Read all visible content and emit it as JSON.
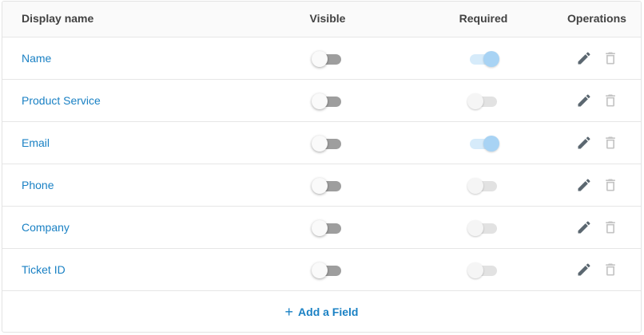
{
  "table": {
    "headers": {
      "display_name": "Display name",
      "visible": "Visible",
      "required": "Required",
      "operations": "Operations"
    },
    "rows": [
      {
        "name": "Name",
        "visible": false,
        "required": true,
        "required_enabled": true
      },
      {
        "name": "Product Service",
        "visible": false,
        "required": false,
        "required_enabled": false
      },
      {
        "name": "Email",
        "visible": false,
        "required": true,
        "required_enabled": true
      },
      {
        "name": "Phone",
        "visible": false,
        "required": false,
        "required_enabled": false
      },
      {
        "name": "Company",
        "visible": false,
        "required": false,
        "required_enabled": false
      },
      {
        "name": "Ticket ID",
        "visible": false,
        "required": false,
        "required_enabled": false
      }
    ]
  },
  "add_field": {
    "icon": "plus-icon",
    "label": "Add a Field"
  },
  "colors": {
    "link": "#1a81c4",
    "toggle_on": "#a8d3f4",
    "toggle_off": "#9e9e9e",
    "icon_edit": "#5b6770",
    "icon_delete_disabled": "#c4c4c4"
  }
}
